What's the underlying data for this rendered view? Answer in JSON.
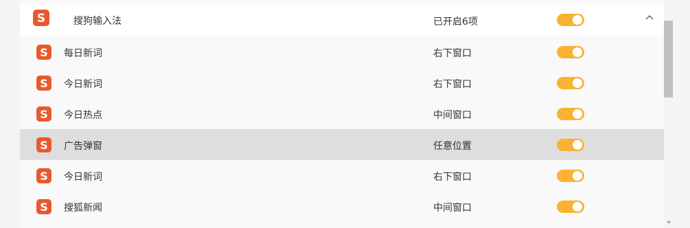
{
  "header": {
    "name": "搜狗输入法",
    "status": "已开启6项",
    "icon": "sogou-logo-icon",
    "toggle_on": true,
    "expanded": true
  },
  "items": [
    {
      "name": "每日新词",
      "status": "右下窗口",
      "icon": "sogou-logo-icon",
      "toggle_on": true
    },
    {
      "name": "今日新词",
      "status": "右下窗口",
      "icon": "sogou-logo-icon",
      "toggle_on": true
    },
    {
      "name": "今日热点",
      "status": "中间窗口",
      "icon": "sogou-logo-icon",
      "toggle_on": true
    },
    {
      "name": "广告弹窗",
      "status": "任意位置",
      "icon": "sogou-logo-icon",
      "toggle_on": true,
      "highlighted": true
    },
    {
      "name": "今日新词",
      "status": "右下窗口",
      "icon": "sogou-logo-icon",
      "toggle_on": true
    },
    {
      "name": "搜狐新闻",
      "status": "中间窗口",
      "icon": "sogou-logo-icon",
      "toggle_on": true
    }
  ],
  "colors": {
    "accent": "#f9b232",
    "logo": "#e8592d",
    "highlight": "#dedede"
  }
}
